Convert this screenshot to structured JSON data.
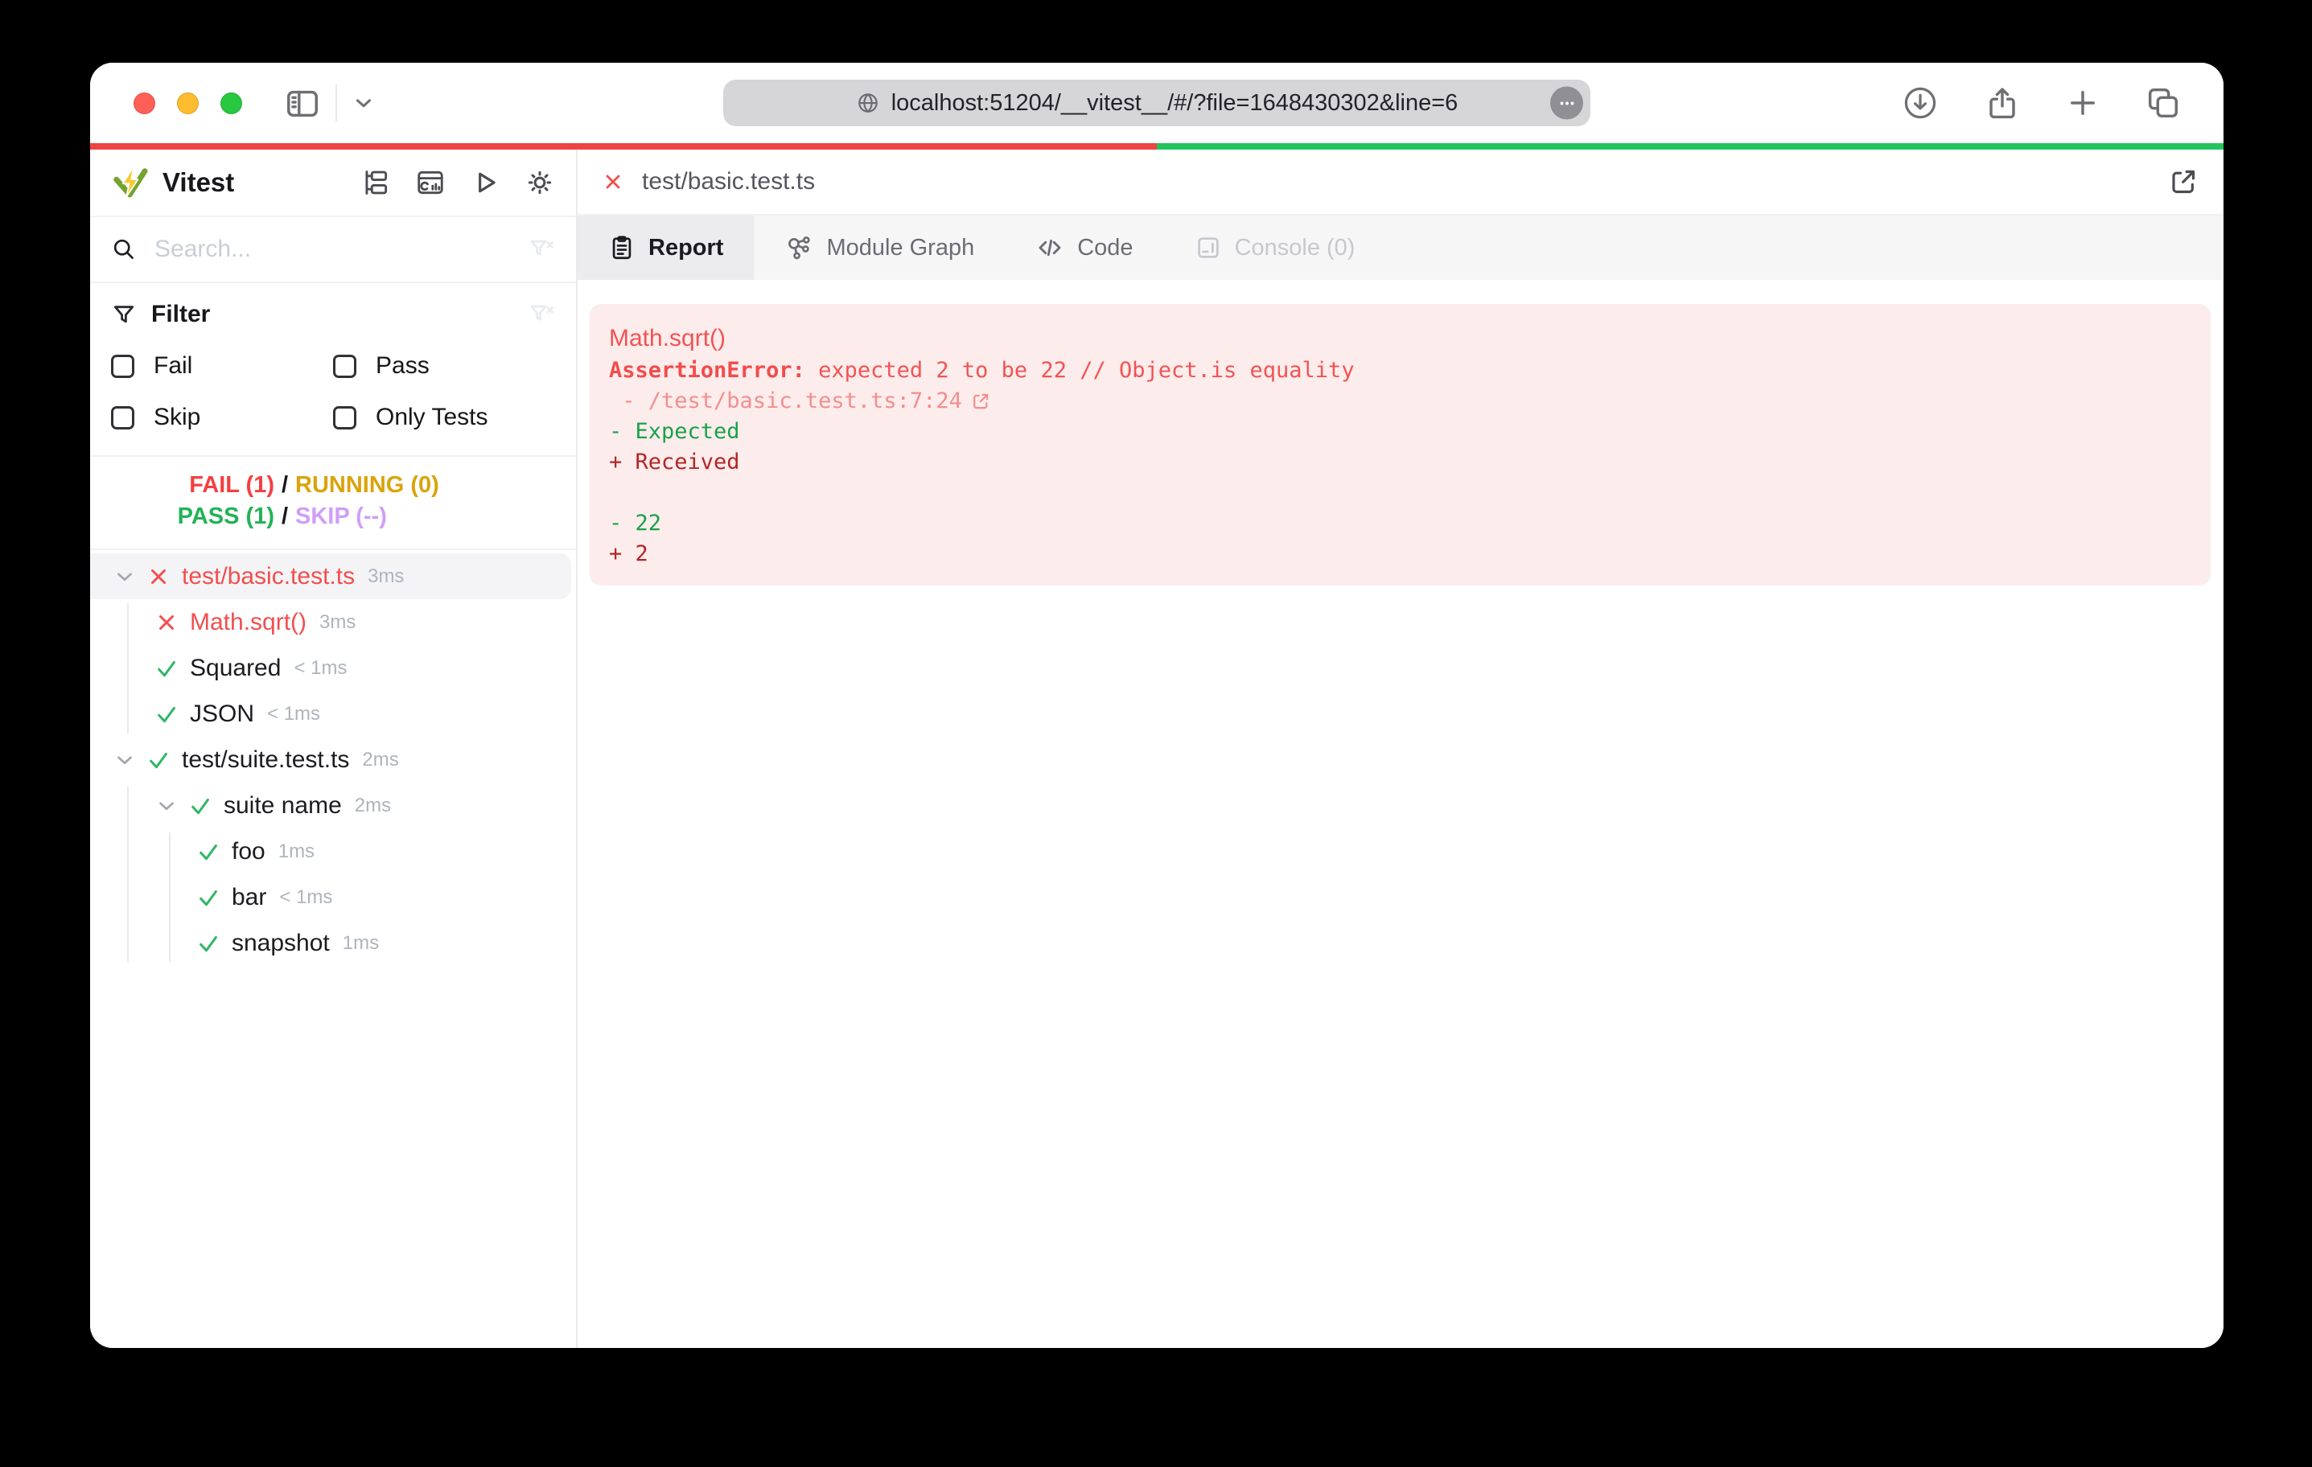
{
  "browser": {
    "url": "localhost:51204/__vitest__/#/?file=1648430302&line=6",
    "traffic_lights": [
      {
        "name": "close",
        "color": "#ff5f57"
      },
      {
        "name": "minimize",
        "color": "#febc2e"
      },
      {
        "name": "zoom",
        "color": "#28c840"
      }
    ],
    "left_actions": [
      {
        "icon": "sidebar-toggle-icon"
      },
      {
        "icon": "chevron-down-icon"
      }
    ],
    "url_icons": {
      "globe": "globe-icon",
      "more": "ellipsis-icon"
    },
    "right_actions": [
      {
        "icon": "download-icon"
      },
      {
        "icon": "share-icon"
      },
      {
        "icon": "new-tab-icon"
      },
      {
        "icon": "tab-overview-icon"
      }
    ]
  },
  "progress": {
    "fail_color": "#ef4444",
    "pass_color": "#23c45e",
    "fail_fraction": 0.5
  },
  "sidebar": {
    "title": "Vitest",
    "actions": [
      {
        "icon": "tree-view-icon"
      },
      {
        "icon": "dashboard-icon"
      },
      {
        "icon": "run-all-icon"
      },
      {
        "icon": "theme-toggle-icon"
      }
    ],
    "search_placeholder": "Search...",
    "filter": {
      "label": "Filter",
      "options": [
        {
          "label": "Fail",
          "checked": false
        },
        {
          "label": "Pass",
          "checked": false
        },
        {
          "label": "Skip",
          "checked": false
        },
        {
          "label": "Only Tests",
          "checked": false
        }
      ]
    },
    "summary": {
      "fail": "FAIL (1)",
      "running": "RUNNING (0)",
      "pass": "PASS (1)",
      "skip": "SKIP (--)",
      "separator": "/"
    },
    "tree": [
      {
        "label": "test/basic.test.ts",
        "duration": "3ms",
        "status": "fail",
        "icon": "x-icon",
        "level": 0,
        "chevron": true,
        "selected": true
      },
      {
        "label": "Math.sqrt()",
        "duration": "3ms",
        "status": "fail",
        "icon": "x-icon",
        "level": 1,
        "chevron": false,
        "selected": false
      },
      {
        "label": "Squared",
        "duration": "< 1ms",
        "status": "pass",
        "icon": "check-icon",
        "level": 1,
        "chevron": false,
        "selected": false
      },
      {
        "label": "JSON",
        "duration": "< 1ms",
        "status": "pass",
        "icon": "check-icon",
        "level": 1,
        "chevron": false,
        "selected": false
      },
      {
        "label": "test/suite.test.ts",
        "duration": "2ms",
        "status": "pass",
        "icon": "check-icon",
        "level": 0,
        "chevron": true,
        "selected": false
      },
      {
        "label": "suite name",
        "duration": "2ms",
        "status": "pass",
        "icon": "check-icon",
        "level": 1,
        "chevron": true,
        "selected": false
      },
      {
        "label": "foo",
        "duration": "1ms",
        "status": "pass",
        "icon": "check-icon",
        "level": 2,
        "chevron": false,
        "selected": false
      },
      {
        "label": "bar",
        "duration": "< 1ms",
        "status": "pass",
        "icon": "check-icon",
        "level": 2,
        "chevron": false,
        "selected": false
      },
      {
        "label": "snapshot",
        "duration": "1ms",
        "status": "pass",
        "icon": "check-icon",
        "level": 2,
        "chevron": false,
        "selected": false
      }
    ]
  },
  "main": {
    "file_tab": {
      "label": "test/basic.test.ts",
      "status_icon": "x-icon"
    },
    "open_external_icon": "external-link-icon",
    "tabs": [
      {
        "label": "Report",
        "icon": "report-icon",
        "active": true,
        "disabled": false
      },
      {
        "label": "Module Graph",
        "icon": "module-graph-icon",
        "active": false,
        "disabled": false
      },
      {
        "label": "Code",
        "icon": "code-icon",
        "active": false,
        "disabled": false
      },
      {
        "label": "Console (0)",
        "icon": "console-icon",
        "active": false,
        "disabled": true
      }
    ],
    "report": {
      "title": "Math.sqrt()",
      "error_name": "AssertionError:",
      "error_message": " expected 2 to be 22 // Object.is equality",
      "location": " - /test/basic.test.ts:7:24",
      "location_icon": "external-link-icon",
      "diff": [
        {
          "text": "- Expected",
          "kind": "expected"
        },
        {
          "text": "+ Received",
          "kind": "received"
        },
        {
          "text": "",
          "kind": "blank"
        },
        {
          "text": "- 22",
          "kind": "expected"
        },
        {
          "text": "+ 2",
          "kind": "received"
        }
      ],
      "background": "#fdecec"
    }
  }
}
